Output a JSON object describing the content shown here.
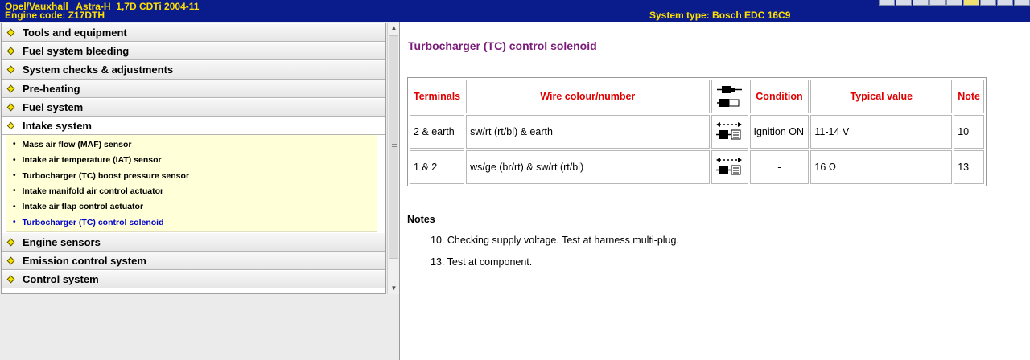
{
  "header": {
    "vehicle": "Opel/Vauxhall   Astra-H  1,7D CDTi 2004-11",
    "engine_code": "Engine code: Z17DTH",
    "system_type": "System type: Bosch EDC 16C9"
  },
  "nav": {
    "categories_top": [
      {
        "label": "Tools and equipment"
      },
      {
        "label": "Fuel system bleeding"
      },
      {
        "label": "System checks & adjustments"
      },
      {
        "label": "Pre-heating"
      },
      {
        "label": "Fuel system"
      }
    ],
    "open_category": {
      "label": "Intake system"
    },
    "subitems": [
      {
        "label": "Mass air flow (MAF) sensor"
      },
      {
        "label": "Intake air temperature (IAT) sensor"
      },
      {
        "label": "Turbocharger (TC) boost pressure sensor"
      },
      {
        "label": "Intake manifold air control actuator"
      },
      {
        "label": "Intake air flap control actuator"
      },
      {
        "label": "Turbocharger (TC) control solenoid"
      }
    ],
    "categories_bottom": [
      {
        "label": "Engine sensors"
      },
      {
        "label": "Emission control system"
      },
      {
        "label": "Control system"
      }
    ]
  },
  "main": {
    "title": "Turbocharger (TC) control solenoid",
    "table": {
      "headers": {
        "terminals": "Terminals",
        "wire": "Wire colour/number",
        "condition": "Condition",
        "typical": "Typical value",
        "note": "Note"
      },
      "connector_icon": "connector-unplugged-icon",
      "rows": [
        {
          "terminals": "2 & earth",
          "wire": "sw/rt (rt/bl) & earth",
          "icon": "connector-backprobe-icon",
          "condition": "Ignition ON",
          "typical": "11-14 V",
          "note": "10"
        },
        {
          "terminals": "1 & 2",
          "wire": "ws/ge (br/rt) & sw/rt (rt/bl)",
          "icon": "connector-backprobe-icon",
          "condition": "-",
          "typical": "16 Ω",
          "note": "13"
        }
      ]
    },
    "notes_heading": "Notes",
    "notes": [
      "10. Checking supply voltage. Test at harness multi-plug.",
      "13. Test at component."
    ]
  },
  "colors": {
    "header_bg": "#0a1c8c",
    "header_text": "#ffe000",
    "title": "#7a1a7a",
    "table_header": "#e00000",
    "active_link": "#0000cc",
    "sublist_bg": "#ffffd8"
  }
}
